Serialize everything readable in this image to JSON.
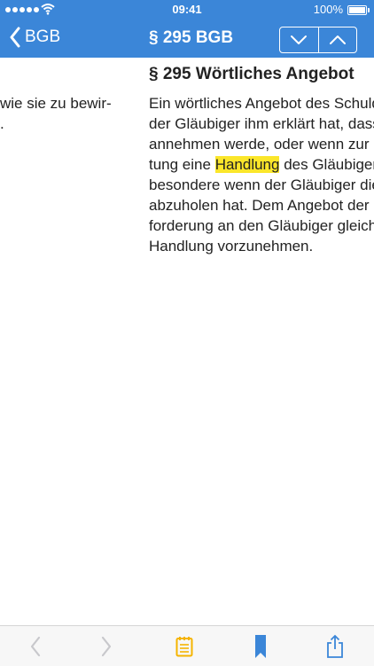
{
  "status": {
    "time": "09:41",
    "battery": "100%"
  },
  "nav": {
    "back_label": "BGB",
    "title": "§ 295 BGB"
  },
  "left_page": {
    "lines": [
      "wie sie zu bewir-",
      "."
    ]
  },
  "article": {
    "heading": "§ 295 Wörtliches Angebot",
    "lines": [
      {
        "text": "Ein wörtliches Angebot des Schuldn"
      },
      {
        "text": "der Gläubiger ihm erklärt hat, dass"
      },
      {
        "text": "annehmen werde, oder wenn zur B"
      },
      {
        "pre": "tung eine ",
        "highlight": "Handlung",
        "post": " des Gläubigers"
      },
      {
        "text": "besondere wenn der Gläubiger die"
      },
      {
        "text": "abzuholen hat. Dem Angebot der Le"
      },
      {
        "text": "forderung an den Gläubiger gleich,"
      },
      {
        "text": "Handlung vorzunehmen."
      }
    ]
  },
  "colors": {
    "header": "#3b86d8",
    "highlight": "#fbe62a",
    "accent": "#3b86d8",
    "disabled": "#c8c8cc",
    "note": "#f5b400"
  },
  "toolbar": {
    "icons": [
      "back-arrow-icon",
      "forward-arrow-icon",
      "note-icon",
      "bookmark-icon",
      "share-icon"
    ]
  }
}
